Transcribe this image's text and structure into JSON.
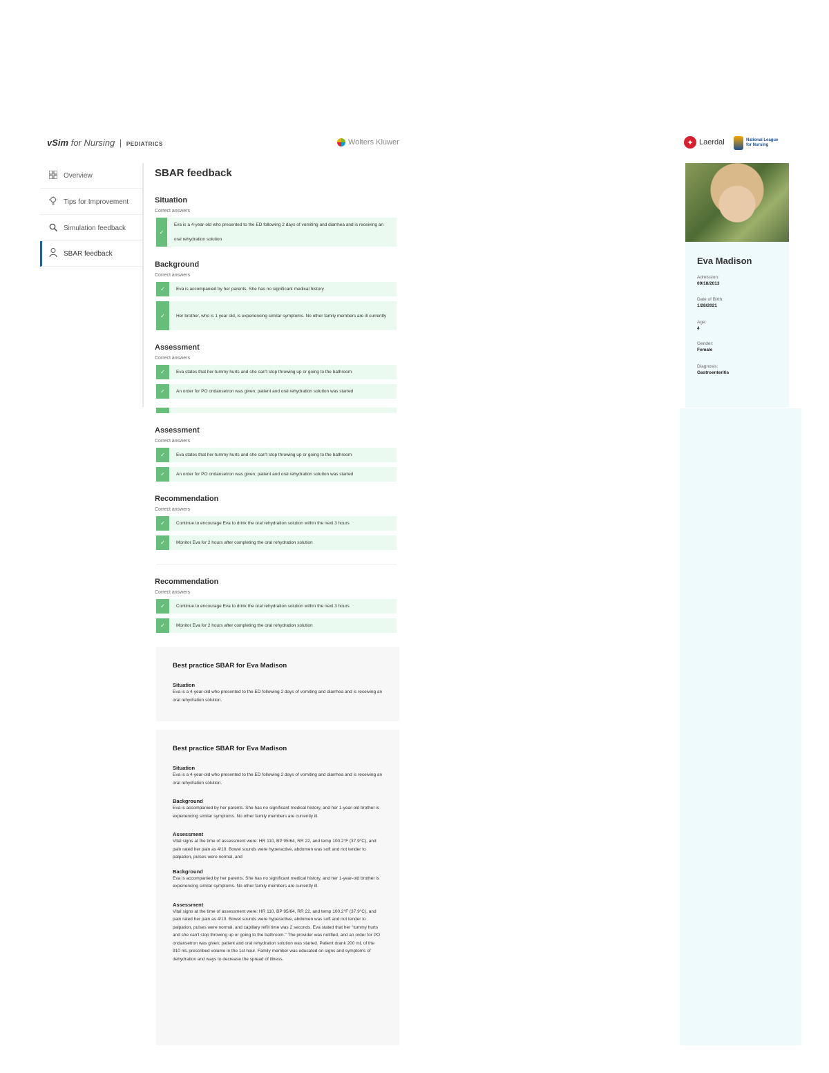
{
  "header": {
    "brand_vsim": "vSim",
    "brand_for_nursing": "for Nursing",
    "brand_sep": "|",
    "brand_sub": "PEDIATRICS",
    "publisher": "Wolters Kluwer",
    "partner_1": "Laerdal",
    "partner_2_line1": "National League",
    "partner_2_line2": "for Nursing"
  },
  "sidebar": {
    "items": [
      {
        "label": "Overview",
        "icon": "grid-icon"
      },
      {
        "label": "Tips for Improvement",
        "icon": "lightbulb-icon"
      },
      {
        "label": "Simulation feedback",
        "icon": "search-icon"
      },
      {
        "label": "SBAR feedback",
        "icon": "person-icon"
      }
    ]
  },
  "main": {
    "title": "SBAR feedback",
    "correct_label": "Correct answers",
    "situation": {
      "title": "Situation",
      "answers": [
        "Eva is a 4-year-old who presented to the ED following 2 days of vomiting and diarrhea and is receiving an oral rehydration solution"
      ]
    },
    "background": {
      "title": "Background",
      "answers": [
        "Eva is accompanied by her parents. She has no significant medical history",
        "Her brother, who is 1 year old, is experiencing similar symptoms. No other family members are ill currently"
      ]
    },
    "assessment": {
      "title": "Assessment",
      "answers": [
        "Eva states that her tummy hurts and she can't stop throwing up or going to the bathroom",
        "An order for PO ondansetron was given; patient and oral rehydration solution was started"
      ]
    },
    "recommendation": {
      "title": "Recommendation",
      "answers": [
        "Continue to encourage Eva to drink the oral rehydration solution within the next 3 hours",
        "Monitor Eva for 2 hours after completing the oral rehydration solution"
      ]
    },
    "best_practice": {
      "title": "Best practice SBAR for Eva Madison",
      "situation_h": "Situation",
      "situation_p": "Eva is a 4-year-old who presented to the ED following 2 days of vomiting and diarrhea and is receiving an oral rehydration solution.",
      "background_h": "Background",
      "background_p": "Eva is accompanied by her parents. She has no significant medical history, and her 1-year-old brother is experiencing similar symptoms. No other family members are currently ill.",
      "assessment_h": "Assessment",
      "assessment_p1": "Vital signs at the time of assessment were: HR 110, BP 95/64, RR 22, and temp 100.2°F (37.9°C), and pain rated her pain as 4/10. Bowel sounds were hyperactive, abdomen was soft and not tender to palpation, pulses were normal, and",
      "assessment_p2": "Vital signs at the time of assessment were: HR 110, BP 95/64, RR 22, and temp 100.2°F (37.9°C), and pain rated her pain as 4/10. Bowel sounds were hyperactive, abdomen was soft and not tender to palpation, pulses were normal, and capillary refill time was 2 seconds. Eva stated that her \"tummy hurts and she can't stop throwing up or going to the bathroom.\" The provider was notified, and an order for PO ondansetron was given; patient and oral rehydration solution was started. Patient drank 200 mL of the 910 mL prescribed volume in the 1st hour. Family member was educated on signs and symptoms of dehydration and ways to decrease the spread of illness."
    }
  },
  "patient": {
    "name": "Eva Madison",
    "admission_label": "Admission:",
    "admission_value": "09/18/2013",
    "dob_label": "Date of Birth:",
    "dob_value": "1/28/2021",
    "age_label": "Age:",
    "age_value": "4",
    "gender_label": "Gender:",
    "gender_value": "Female",
    "diagnosis_label": "Diagnosis:",
    "diagnosis_value": "Gastroenteritis"
  },
  "colors": {
    "accent": "#1f5ea8",
    "check": "#67bd7a",
    "answer_bg": "#eafaf0",
    "card_bg": "#eefafb"
  }
}
